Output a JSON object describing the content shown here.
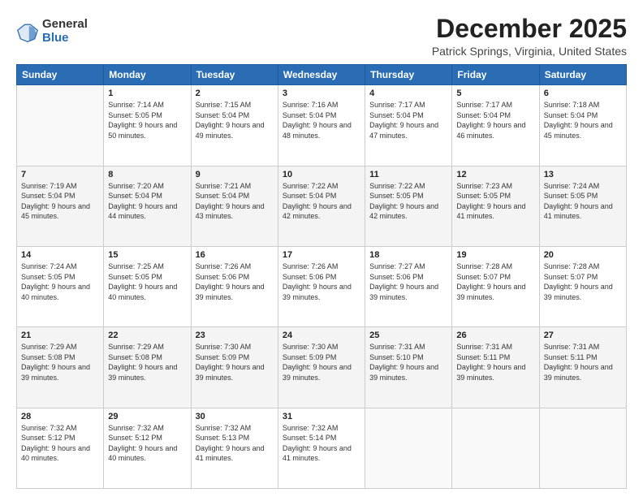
{
  "header": {
    "logo_general": "General",
    "logo_blue": "Blue",
    "month_title": "December 2025",
    "location": "Patrick Springs, Virginia, United States"
  },
  "weekdays": [
    "Sunday",
    "Monday",
    "Tuesday",
    "Wednesday",
    "Thursday",
    "Friday",
    "Saturday"
  ],
  "weeks": [
    [
      {
        "day": "",
        "sunrise": "",
        "sunset": "",
        "daylight": ""
      },
      {
        "day": "1",
        "sunrise": "Sunrise: 7:14 AM",
        "sunset": "Sunset: 5:05 PM",
        "daylight": "Daylight: 9 hours and 50 minutes."
      },
      {
        "day": "2",
        "sunrise": "Sunrise: 7:15 AM",
        "sunset": "Sunset: 5:04 PM",
        "daylight": "Daylight: 9 hours and 49 minutes."
      },
      {
        "day": "3",
        "sunrise": "Sunrise: 7:16 AM",
        "sunset": "Sunset: 5:04 PM",
        "daylight": "Daylight: 9 hours and 48 minutes."
      },
      {
        "day": "4",
        "sunrise": "Sunrise: 7:17 AM",
        "sunset": "Sunset: 5:04 PM",
        "daylight": "Daylight: 9 hours and 47 minutes."
      },
      {
        "day": "5",
        "sunrise": "Sunrise: 7:17 AM",
        "sunset": "Sunset: 5:04 PM",
        "daylight": "Daylight: 9 hours and 46 minutes."
      },
      {
        "day": "6",
        "sunrise": "Sunrise: 7:18 AM",
        "sunset": "Sunset: 5:04 PM",
        "daylight": "Daylight: 9 hours and 45 minutes."
      }
    ],
    [
      {
        "day": "7",
        "sunrise": "Sunrise: 7:19 AM",
        "sunset": "Sunset: 5:04 PM",
        "daylight": "Daylight: 9 hours and 45 minutes."
      },
      {
        "day": "8",
        "sunrise": "Sunrise: 7:20 AM",
        "sunset": "Sunset: 5:04 PM",
        "daylight": "Daylight: 9 hours and 44 minutes."
      },
      {
        "day": "9",
        "sunrise": "Sunrise: 7:21 AM",
        "sunset": "Sunset: 5:04 PM",
        "daylight": "Daylight: 9 hours and 43 minutes."
      },
      {
        "day": "10",
        "sunrise": "Sunrise: 7:22 AM",
        "sunset": "Sunset: 5:04 PM",
        "daylight": "Daylight: 9 hours and 42 minutes."
      },
      {
        "day": "11",
        "sunrise": "Sunrise: 7:22 AM",
        "sunset": "Sunset: 5:05 PM",
        "daylight": "Daylight: 9 hours and 42 minutes."
      },
      {
        "day": "12",
        "sunrise": "Sunrise: 7:23 AM",
        "sunset": "Sunset: 5:05 PM",
        "daylight": "Daylight: 9 hours and 41 minutes."
      },
      {
        "day": "13",
        "sunrise": "Sunrise: 7:24 AM",
        "sunset": "Sunset: 5:05 PM",
        "daylight": "Daylight: 9 hours and 41 minutes."
      }
    ],
    [
      {
        "day": "14",
        "sunrise": "Sunrise: 7:24 AM",
        "sunset": "Sunset: 5:05 PM",
        "daylight": "Daylight: 9 hours and 40 minutes."
      },
      {
        "day": "15",
        "sunrise": "Sunrise: 7:25 AM",
        "sunset": "Sunset: 5:05 PM",
        "daylight": "Daylight: 9 hours and 40 minutes."
      },
      {
        "day": "16",
        "sunrise": "Sunrise: 7:26 AM",
        "sunset": "Sunset: 5:06 PM",
        "daylight": "Daylight: 9 hours and 39 minutes."
      },
      {
        "day": "17",
        "sunrise": "Sunrise: 7:26 AM",
        "sunset": "Sunset: 5:06 PM",
        "daylight": "Daylight: 9 hours and 39 minutes."
      },
      {
        "day": "18",
        "sunrise": "Sunrise: 7:27 AM",
        "sunset": "Sunset: 5:06 PM",
        "daylight": "Daylight: 9 hours and 39 minutes."
      },
      {
        "day": "19",
        "sunrise": "Sunrise: 7:28 AM",
        "sunset": "Sunset: 5:07 PM",
        "daylight": "Daylight: 9 hours and 39 minutes."
      },
      {
        "day": "20",
        "sunrise": "Sunrise: 7:28 AM",
        "sunset": "Sunset: 5:07 PM",
        "daylight": "Daylight: 9 hours and 39 minutes."
      }
    ],
    [
      {
        "day": "21",
        "sunrise": "Sunrise: 7:29 AM",
        "sunset": "Sunset: 5:08 PM",
        "daylight": "Daylight: 9 hours and 39 minutes."
      },
      {
        "day": "22",
        "sunrise": "Sunrise: 7:29 AM",
        "sunset": "Sunset: 5:08 PM",
        "daylight": "Daylight: 9 hours and 39 minutes."
      },
      {
        "day": "23",
        "sunrise": "Sunrise: 7:30 AM",
        "sunset": "Sunset: 5:09 PM",
        "daylight": "Daylight: 9 hours and 39 minutes."
      },
      {
        "day": "24",
        "sunrise": "Sunrise: 7:30 AM",
        "sunset": "Sunset: 5:09 PM",
        "daylight": "Daylight: 9 hours and 39 minutes."
      },
      {
        "day": "25",
        "sunrise": "Sunrise: 7:31 AM",
        "sunset": "Sunset: 5:10 PM",
        "daylight": "Daylight: 9 hours and 39 minutes."
      },
      {
        "day": "26",
        "sunrise": "Sunrise: 7:31 AM",
        "sunset": "Sunset: 5:11 PM",
        "daylight": "Daylight: 9 hours and 39 minutes."
      },
      {
        "day": "27",
        "sunrise": "Sunrise: 7:31 AM",
        "sunset": "Sunset: 5:11 PM",
        "daylight": "Daylight: 9 hours and 39 minutes."
      }
    ],
    [
      {
        "day": "28",
        "sunrise": "Sunrise: 7:32 AM",
        "sunset": "Sunset: 5:12 PM",
        "daylight": "Daylight: 9 hours and 40 minutes."
      },
      {
        "day": "29",
        "sunrise": "Sunrise: 7:32 AM",
        "sunset": "Sunset: 5:12 PM",
        "daylight": "Daylight: 9 hours and 40 minutes."
      },
      {
        "day": "30",
        "sunrise": "Sunrise: 7:32 AM",
        "sunset": "Sunset: 5:13 PM",
        "daylight": "Daylight: 9 hours and 41 minutes."
      },
      {
        "day": "31",
        "sunrise": "Sunrise: 7:32 AM",
        "sunset": "Sunset: 5:14 PM",
        "daylight": "Daylight: 9 hours and 41 minutes."
      },
      {
        "day": "",
        "sunrise": "",
        "sunset": "",
        "daylight": ""
      },
      {
        "day": "",
        "sunrise": "",
        "sunset": "",
        "daylight": ""
      },
      {
        "day": "",
        "sunrise": "",
        "sunset": "",
        "daylight": ""
      }
    ]
  ]
}
